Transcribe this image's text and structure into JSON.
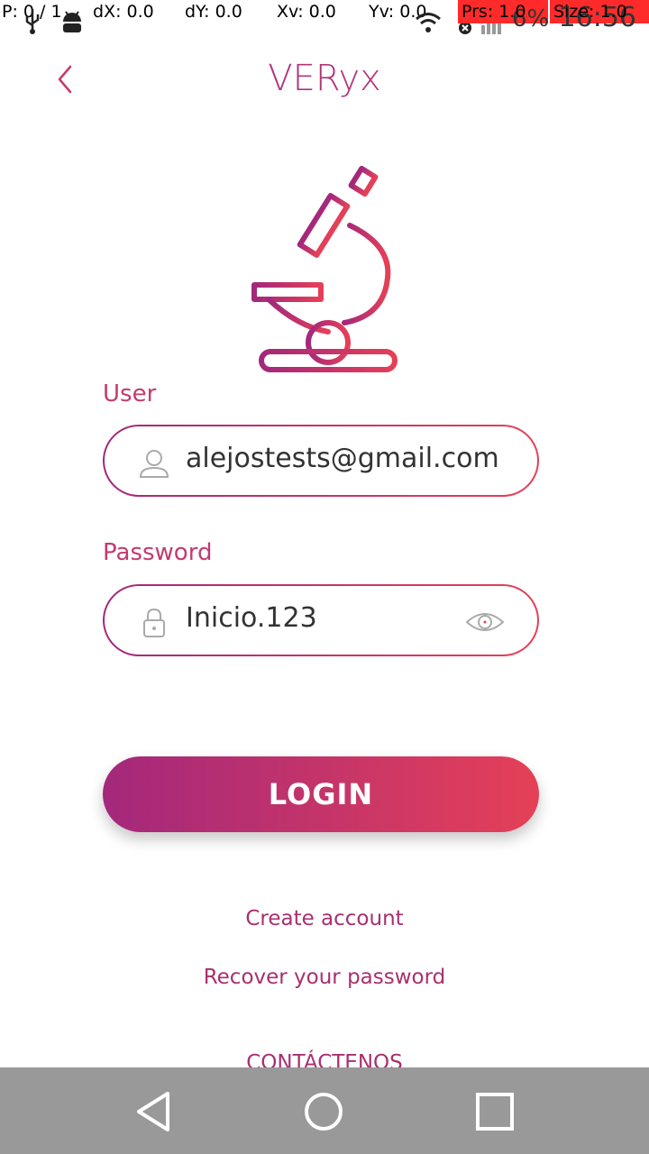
{
  "status_bar": {
    "debug": {
      "pointer": "P: 0 / 1",
      "dx": "dX: 0.0",
      "dy": "dY: 0.0",
      "xv": "Xv: 0.0",
      "yv": "Yv: 0.0",
      "prs": "Prs: 1.0",
      "size": "Size: 1.0"
    },
    "battery": "6%",
    "clock": "16:56",
    "overlay_color": "#ff2b2b"
  },
  "header": {
    "back_icon": "chevron-left-icon",
    "title": "VERyx"
  },
  "logo": {
    "icon": "microscope-icon"
  },
  "form": {
    "user_label": "User",
    "user_value": "alejostests@gmail.com",
    "user_icon": "user-icon",
    "password_label": "Password",
    "password_value": "Inicio.123",
    "password_icon": "lock-icon",
    "show_password_icon": "eye-icon"
  },
  "actions": {
    "login_label": "LOGIN",
    "create_account": "Create account",
    "recover_password": "Recover your password",
    "contact": "CONTÁCTENOS"
  },
  "colors": {
    "accent": "#b3347a",
    "gradient_start": "#a3287c",
    "gradient_end": "#e54057",
    "navbar": "#999999"
  },
  "nav_bar": {
    "back": "back-triangle-icon",
    "home": "home-circle-icon",
    "recents": "recents-square-icon"
  }
}
